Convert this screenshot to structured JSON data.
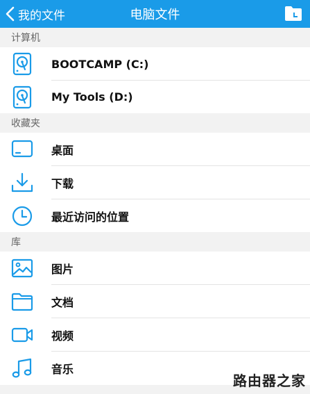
{
  "navbar": {
    "back_label": "我的文件",
    "title": "电脑文件",
    "action_icon": "folder-icon"
  },
  "sections": [
    {
      "header": "计算机",
      "items": [
        {
          "label": "BOOTCAMP (C:)",
          "icon": "hard-drive-icon"
        },
        {
          "label": "My Tools (D:)",
          "icon": "hard-drive-icon"
        }
      ]
    },
    {
      "header": "收藏夹",
      "items": [
        {
          "label": "桌面",
          "icon": "desktop-icon"
        },
        {
          "label": "下载",
          "icon": "download-icon"
        },
        {
          "label": "最近访问的位置",
          "icon": "clock-icon"
        }
      ]
    },
    {
      "header": "库",
      "items": [
        {
          "label": "图片",
          "icon": "picture-icon"
        },
        {
          "label": "文档",
          "icon": "folder-icon"
        },
        {
          "label": "视频",
          "icon": "video-icon"
        },
        {
          "label": "音乐",
          "icon": "music-icon"
        }
      ]
    }
  ],
  "watermark": "路由器之家",
  "colors": {
    "accent": "#1a9be8",
    "icon": "#1a9be8",
    "background": "#f2f2f2",
    "row": "#ffffff"
  }
}
